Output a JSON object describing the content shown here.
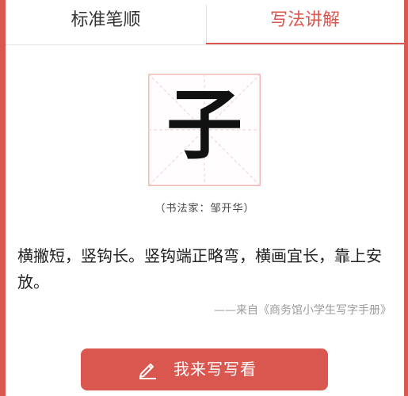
{
  "tabs": {
    "left_label": "标准笔顺",
    "right_label": "写法讲解",
    "active": "right"
  },
  "character": {
    "glyph": "子",
    "credit": "（书法家：邹开华）"
  },
  "explanation": {
    "text": "横撇短，竖钩长。竖钩端正略弯，横画宜长，靠上安放。",
    "source": "——来自《商务馆小学生写字手册》"
  },
  "practice_button": {
    "label": "我来写写看",
    "icon": "pencil-icon"
  },
  "colors": {
    "accent": "#d9574f",
    "grid": "#f0b9b5",
    "text": "#222222",
    "muted": "#9a9a9a"
  }
}
